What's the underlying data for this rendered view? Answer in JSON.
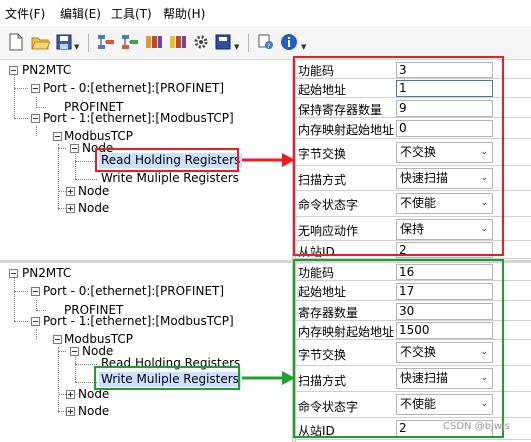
{
  "menu": [
    "文件(F)",
    "编辑(E)",
    "工具(T)",
    "帮助(H)"
  ],
  "toolbar_icons": [
    "new-document-icon",
    "open-folder-icon",
    "save-icon",
    "tool-a-icon",
    "tool-b-icon",
    "tool-c-icon",
    "tool-d-icon",
    "gear-icon",
    "tool-e-icon",
    "settings-icon",
    "info-icon"
  ],
  "colors": {
    "red_annotation": "#ee1c24",
    "green_annotation": "#1fa02a",
    "selection": "#cce0ff"
  },
  "tree1": {
    "root": "PN2MTC",
    "port0": "Port - 0:[ethernet]:[PROFINET]",
    "profinet": "PROFINET",
    "port1": "Port - 1:[ethernet]:[ModbusTCP]",
    "modbus": "ModbusTCP",
    "node_a": "Node",
    "read_holding": "Read Holding Registers",
    "write_multiple": "Write Muliple Registers",
    "node_b": "Node",
    "node_c": "Node"
  },
  "tree2": {
    "root": "PN2MTC",
    "port0": "Port - 0:[ethernet]:[PROFINET]",
    "profinet": "PROFINET",
    "port1": "Port - 1:[ethernet]:[ModbusTCP]",
    "modbus": "ModbusTCP",
    "node_a": "Node",
    "read_holding": "Read Holding Registers",
    "write_multiple": "Write Muliple Registers",
    "node_b": "Node",
    "node_c": "Node"
  },
  "props1": {
    "function_code_label": "功能码",
    "function_code_value": "3",
    "start_addr_label": "起始地址",
    "start_addr_value": "1",
    "count_label": "保持寄存器数量",
    "count_value": "9",
    "mem_start_label": "内存映射起始地址",
    "mem_start_value": "0",
    "byte_swap_label": "字节交换",
    "byte_swap_value": "不交换",
    "scan_mode_label": "扫描方式",
    "scan_mode_value": "快速扫描",
    "cmd_status_label": "命令状态字",
    "cmd_status_value": "不使能",
    "no_resp_label": "无响应动作",
    "no_resp_value": "保持",
    "slave_id_label": "从站ID",
    "slave_id_value": "2"
  },
  "props2": {
    "function_code_label": "功能码",
    "function_code_value": "16",
    "start_addr_label": "起始地址",
    "start_addr_value": "17",
    "count_label": "寄存器数量",
    "count_value": "30",
    "mem_start_label": "内存映射起始地址",
    "mem_start_value": "1500",
    "byte_swap_label": "字节交换",
    "byte_swap_value": "不交换",
    "scan_mode_label": "扫描方式",
    "scan_mode_value": "快速扫描",
    "cmd_status_label": "命令状态字",
    "cmd_status_value": "不使能",
    "slave_id_label": "从站ID",
    "slave_id_value": "2"
  },
  "watermark": "CSDN @bjwjs"
}
